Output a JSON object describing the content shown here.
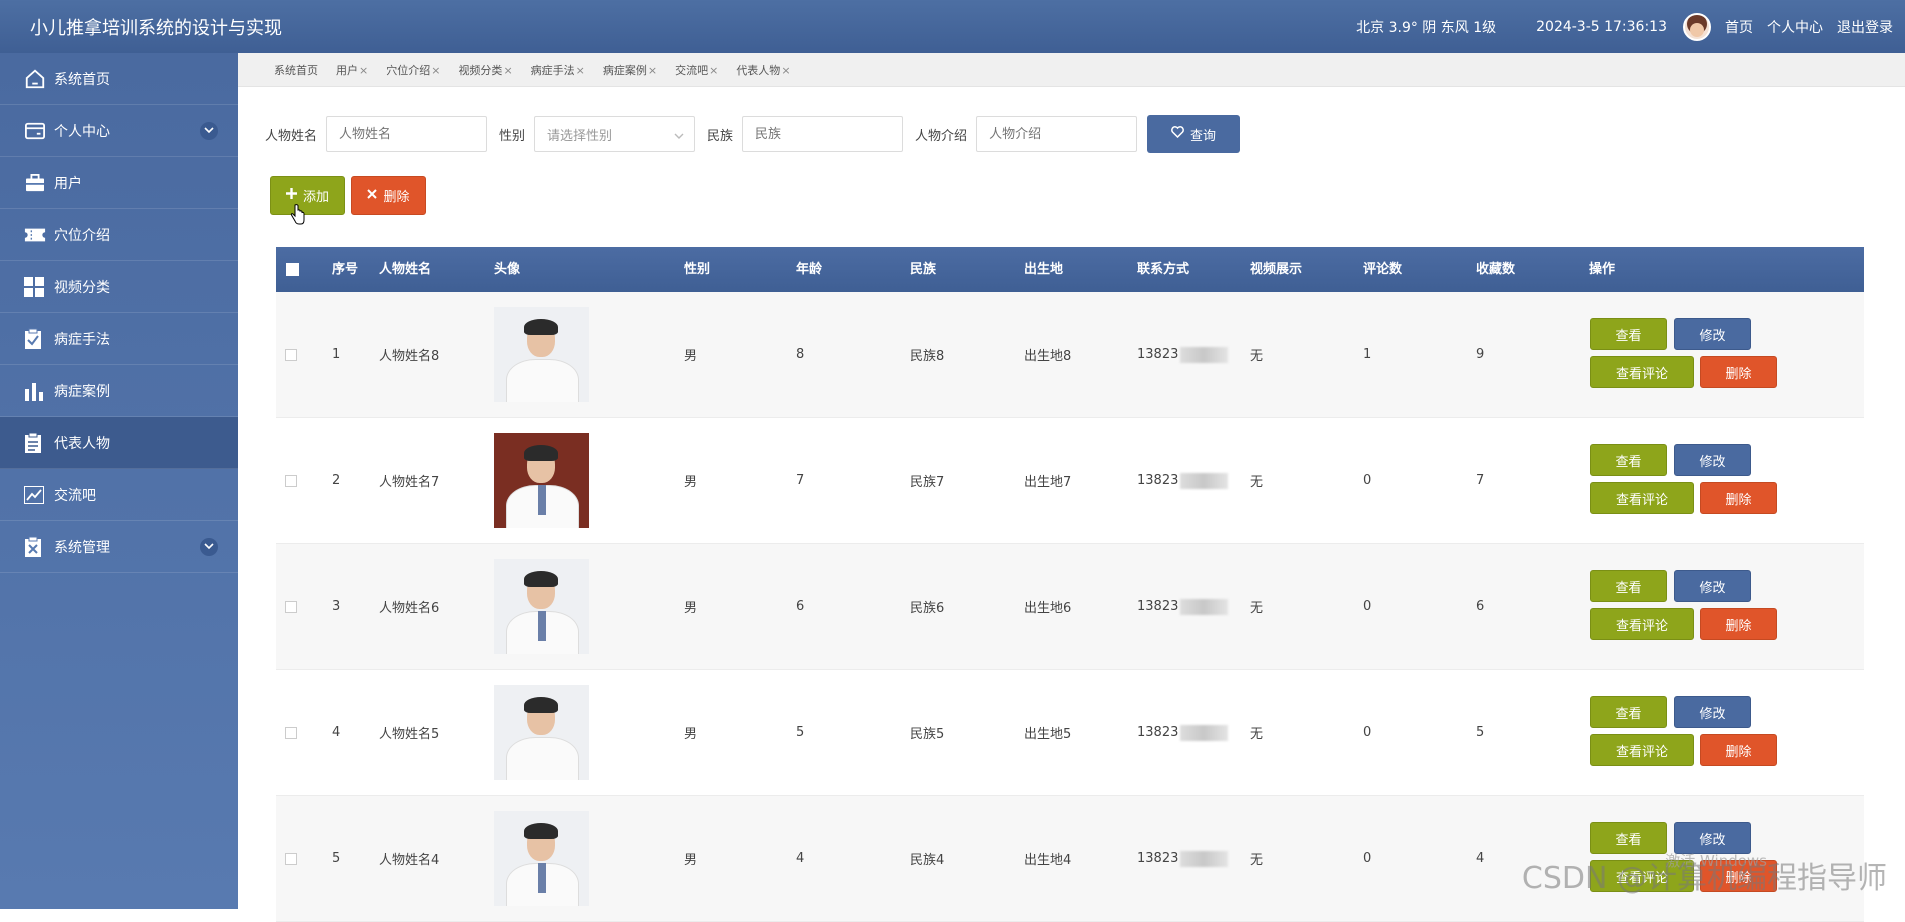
{
  "header": {
    "title": "小儿推拿培训系统的设计与实现",
    "weather": "北京  3.9°  阴  东风  1级",
    "datetime": "2024-3-5 17:36:13",
    "links": [
      "首页",
      "个人中心",
      "退出登录"
    ]
  },
  "sidebar": {
    "items": [
      {
        "label": "系统首页",
        "icon": "home-icon",
        "expandable": false
      },
      {
        "label": "个人中心",
        "icon": "wallet-icon",
        "expandable": true
      },
      {
        "label": "用户",
        "icon": "briefcase-icon",
        "expandable": false
      },
      {
        "label": "穴位介绍",
        "icon": "ticket-icon",
        "expandable": false
      },
      {
        "label": "视频分类",
        "icon": "grid-icon",
        "expandable": false
      },
      {
        "label": "病症手法",
        "icon": "clipboard-check-icon",
        "expandable": false
      },
      {
        "label": "病症案例",
        "icon": "bar-chart-icon",
        "expandable": false
      },
      {
        "label": "代表人物",
        "icon": "list-icon",
        "expandable": false,
        "active": true
      },
      {
        "label": "交流吧",
        "icon": "trend-icon",
        "expandable": false
      },
      {
        "label": "系统管理",
        "icon": "clipboard-x-icon",
        "expandable": true
      }
    ]
  },
  "tabs": [
    "系统首页",
    "用户",
    "穴位介绍",
    "视频分类",
    "病症手法",
    "病症案例",
    "交流吧",
    "代表人物"
  ],
  "search": {
    "name_label": "人物姓名",
    "name_placeholder": "人物姓名",
    "gender_label": "性别",
    "gender_placeholder": "请选择性别",
    "nation_label": "民族",
    "nation_placeholder": "民族",
    "intro_label": "人物介绍",
    "intro_placeholder": "人物介绍",
    "query_label": "查询"
  },
  "actions": {
    "add_label": "添加",
    "delete_label": "删除"
  },
  "table": {
    "headers": [
      "序号",
      "人物姓名",
      "头像",
      "性别",
      "年龄",
      "民族",
      "出生地",
      "联系方式",
      "视频展示",
      "评论数",
      "收藏数",
      "操作"
    ],
    "op_labels": {
      "view": "查看",
      "edit": "修改",
      "comment": "查看评论",
      "remove": "删除"
    },
    "rows": [
      {
        "no": "1",
        "name": "人物姓名8",
        "gender": "男",
        "age": "8",
        "nation": "民族8",
        "birthplace": "出生地8",
        "phone": "13823",
        "video": "无",
        "comments": "1",
        "favorites": "9"
      },
      {
        "no": "2",
        "name": "人物姓名7",
        "gender": "男",
        "age": "7",
        "nation": "民族7",
        "birthplace": "出生地7",
        "phone": "13823",
        "video": "无",
        "comments": "0",
        "favorites": "7"
      },
      {
        "no": "3",
        "name": "人物姓名6",
        "gender": "男",
        "age": "6",
        "nation": "民族6",
        "birthplace": "出生地6",
        "phone": "13823",
        "video": "无",
        "comments": "0",
        "favorites": "6"
      },
      {
        "no": "4",
        "name": "人物姓名5",
        "gender": "男",
        "age": "5",
        "nation": "民族5",
        "birthplace": "出生地5",
        "phone": "13823",
        "video": "无",
        "comments": "0",
        "favorites": "5"
      },
      {
        "no": "5",
        "name": "人物姓名4",
        "gender": "男",
        "age": "4",
        "nation": "民族4",
        "birthplace": "出生地4",
        "phone": "13823",
        "video": "无",
        "comments": "0",
        "favorites": "4"
      }
    ]
  },
  "overlay": {
    "watermark": "CSDN @计算机编程指导师",
    "windows": "激活 Windows"
  }
}
